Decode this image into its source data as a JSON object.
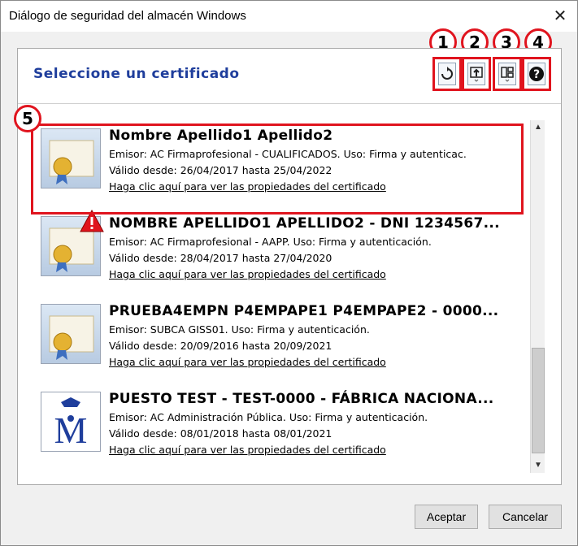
{
  "window": {
    "title": "Diálogo de seguridad del almacén Windows",
    "close_symbol": "✕"
  },
  "header": {
    "title": "Seleccione un certificado"
  },
  "toolbar": {
    "badges": [
      "1",
      "2",
      "3",
      "4"
    ],
    "icons": [
      "refresh-icon",
      "import-icon",
      "view-icon",
      "help-icon"
    ]
  },
  "highlight_badge": "5",
  "certificates": [
    {
      "name": "Nombre Apellido1 Apellido2",
      "issuer": "Emisor: AC Firmaprofesional - CUALIFICADOS. Uso: Firma y autenticac.",
      "validity": "Válido desde: 26/04/2017 hasta 25/04/2022",
      "link": "Haga clic aquí para ver las propiedades del certificado"
    },
    {
      "name": "NOMBRE APELLIDO1 APELLIDO2 - DNI 1234567...",
      "issuer": "Emisor: AC Firmaprofesional - AAPP. Uso: Firma y autenticación.",
      "validity": "Válido desde: 28/04/2017 hasta 27/04/2020",
      "link": "Haga clic aquí para ver las propiedades del certificado"
    },
    {
      "name": "PRUEBA4EMPN P4EMPAPE1 P4EMPAPE2 - 0000...",
      "issuer": "Emisor: SUBCA GISS01. Uso: Firma y autenticación.",
      "validity": "Válido desde: 20/09/2016 hasta 20/09/2021",
      "link": "Haga clic aquí para ver las propiedades del certificado"
    },
    {
      "name": "PUESTO TEST - TEST-0000 - FÁBRICA NACIONA...",
      "issuer": "Emisor: AC Administración Pública. Uso: Firma y autenticación.",
      "validity": "Válido desde: 08/01/2018 hasta 08/01/2021",
      "link": "Haga clic aquí para ver las propiedades del certificado"
    }
  ],
  "footer": {
    "accept_label": "Aceptar",
    "cancel_label": "Cancelar"
  },
  "colors": {
    "accent_title": "#1f3e9c",
    "annotation_red": "#e0141e"
  }
}
